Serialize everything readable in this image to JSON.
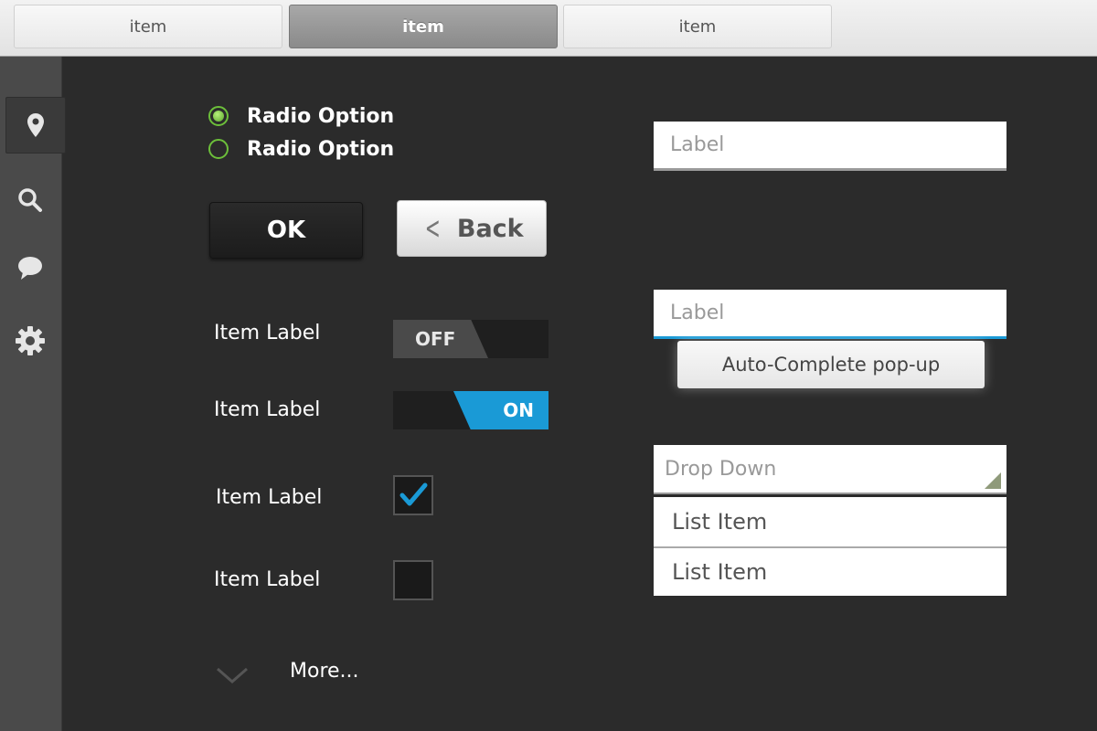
{
  "tabs": [
    {
      "label": "item",
      "active": false
    },
    {
      "label": "item",
      "active": true
    },
    {
      "label": "item",
      "active": false
    }
  ],
  "sidebar": {
    "items": [
      {
        "icon": "location-pin-icon",
        "active": true
      },
      {
        "icon": "search-icon",
        "active": false
      },
      {
        "icon": "chat-bubble-icon",
        "active": false
      },
      {
        "icon": "gear-icon",
        "active": false
      }
    ]
  },
  "radios": [
    {
      "label": "Radio Option",
      "checked": true
    },
    {
      "label": "Radio Option",
      "checked": false
    }
  ],
  "buttons": {
    "ok_label": "OK",
    "back_label": "Back"
  },
  "toggles": [
    {
      "label": "Item Label",
      "state": "OFF"
    },
    {
      "label": "Item Label",
      "state": "ON"
    }
  ],
  "checkboxes": [
    {
      "label": "Item Label",
      "checked": true
    },
    {
      "label": "Item Label",
      "checked": false
    }
  ],
  "more": {
    "label": "More..."
  },
  "fields": {
    "label1_placeholder": "Label",
    "label2_placeholder": "Label",
    "autocomplete": "Auto-Complete pop-up",
    "dropdown": "Drop Down",
    "list_items": [
      "List Item",
      "List Item"
    ]
  },
  "colors": {
    "accent_blue": "#1a9ad6",
    "radio_green": "#6cbf3a",
    "background": "#2b2b2b",
    "sidebar": "#4a4a4a"
  }
}
